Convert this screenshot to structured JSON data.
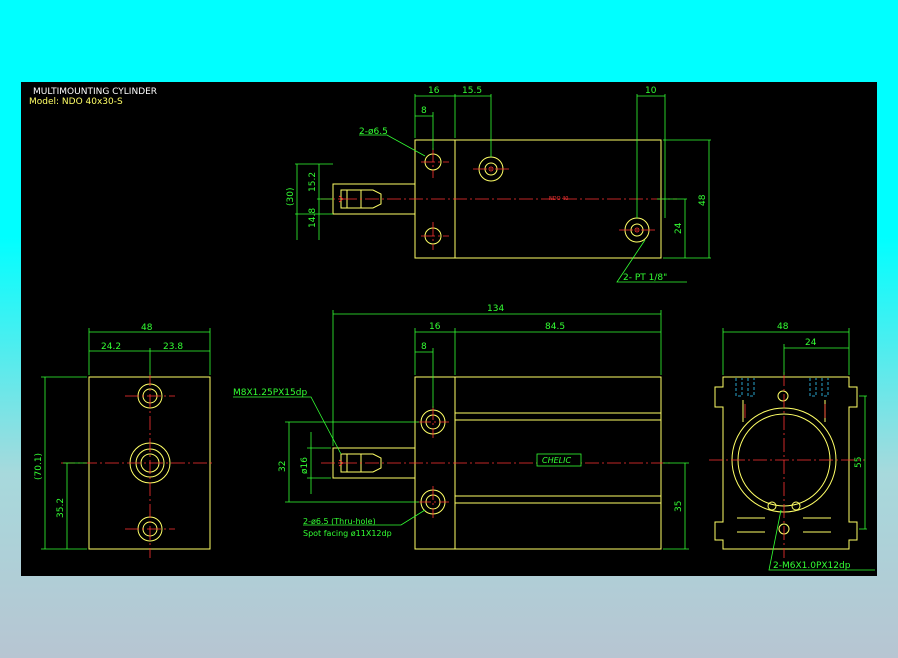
{
  "drawing": {
    "title": "MULTIMOUNTING CYLINDER",
    "model": "Model: NDO 40x30-S"
  },
  "top_view": {
    "dim_16": "16",
    "dim_15_5": "15.5",
    "dim_10": "10",
    "dim_8": "8",
    "hole_label": "2-ø6.5",
    "dim_30": "(30)",
    "dim_15_2": "15.2",
    "dim_14_8": "14.8",
    "dim_48": "48",
    "dim_24": "24",
    "port_label": "2- PT 1/8\"",
    "body_mark": "NDO 40"
  },
  "left_view": {
    "dim_48": "48",
    "dim_24_2": "24.2",
    "dim_23_8": "23.8",
    "dim_70_1": "(70.1)",
    "dim_35_2": "35.2"
  },
  "front_view": {
    "dim_134": "134",
    "dim_16": "16",
    "dim_84_5": "84.5",
    "dim_8": "8",
    "thread_label": "M8X1.25PX15dp",
    "dim_32": "32",
    "dim_d16": "ø16",
    "dim_35": "35",
    "hole_label_1": "2-ø6.5 (Thru-hole)",
    "hole_label_2": "Spot facing  ø11X12dp",
    "logo_text": "CHELIC"
  },
  "right_view": {
    "dim_48": "48",
    "dim_24": "24",
    "dim_55": "55",
    "thread_label": "2-M6X1.0PX12dp"
  }
}
